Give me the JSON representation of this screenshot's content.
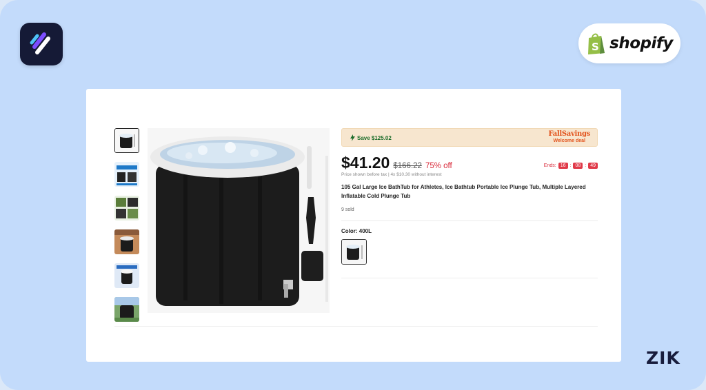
{
  "branding": {
    "app_logo_icon": "app-logo-icon",
    "shopify_icon": "shopify-bag-icon",
    "shopify_text": "shopify",
    "footer_logo": "ZIK"
  },
  "colors": {
    "background": "#c3dbfb",
    "price_discount": "#d92a3a",
    "save_green": "#1c6d2a",
    "deal_banner": "#f7e6cf"
  },
  "product": {
    "gallery": {
      "thumbnail_count": 6,
      "selected_index": 0
    },
    "deal": {
      "save_text": "Save $125.02",
      "campaign_line1": "FallSavings",
      "campaign_line2": "Welcome deal"
    },
    "price": {
      "current": "$41.20",
      "original": "$166.22",
      "discount": "75% off",
      "note": "Price shown before tax",
      "installments": "4x $10.30 without interest"
    },
    "countdown": {
      "label": "Ends:",
      "hours": "16",
      "minutes": "08",
      "seconds": "49"
    },
    "title": "105 Gal Large Ice BathTub for Athletes, Ice Bathtub Portable Ice Plunge Tub, Multiple Layered Inflatable Cold Plunge Tub",
    "sold": "9 sold",
    "color_label": "Color: 400L"
  }
}
